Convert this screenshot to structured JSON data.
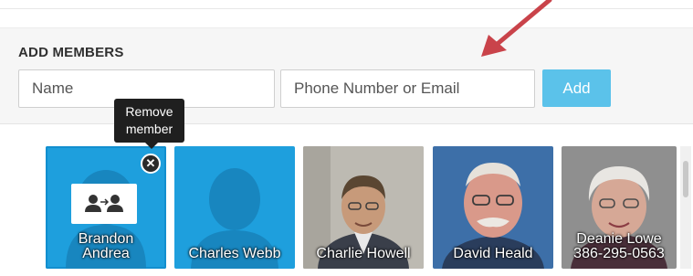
{
  "add_members": {
    "title": "ADD MEMBERS",
    "name_placeholder": "Name",
    "contact_placeholder": "Phone Number or Email",
    "add_label": "Add"
  },
  "tooltip": {
    "line1": "Remove",
    "line2": "member"
  },
  "members": [
    {
      "line1": "Brandon",
      "line2": "Andrea",
      "icon": "group-icon"
    },
    {
      "line1": "Charles Webb",
      "icon": "person-silhouette-icon"
    },
    {
      "line1": "Charlie Howell"
    },
    {
      "line1": "David Heald"
    },
    {
      "line1": "Deanie Lowe",
      "line2": "386-295-0563"
    }
  ],
  "colors": {
    "accent": "#5bc2ea",
    "tile_blue": "#1e9fdd",
    "annotation_arrow": "#c9434a"
  }
}
